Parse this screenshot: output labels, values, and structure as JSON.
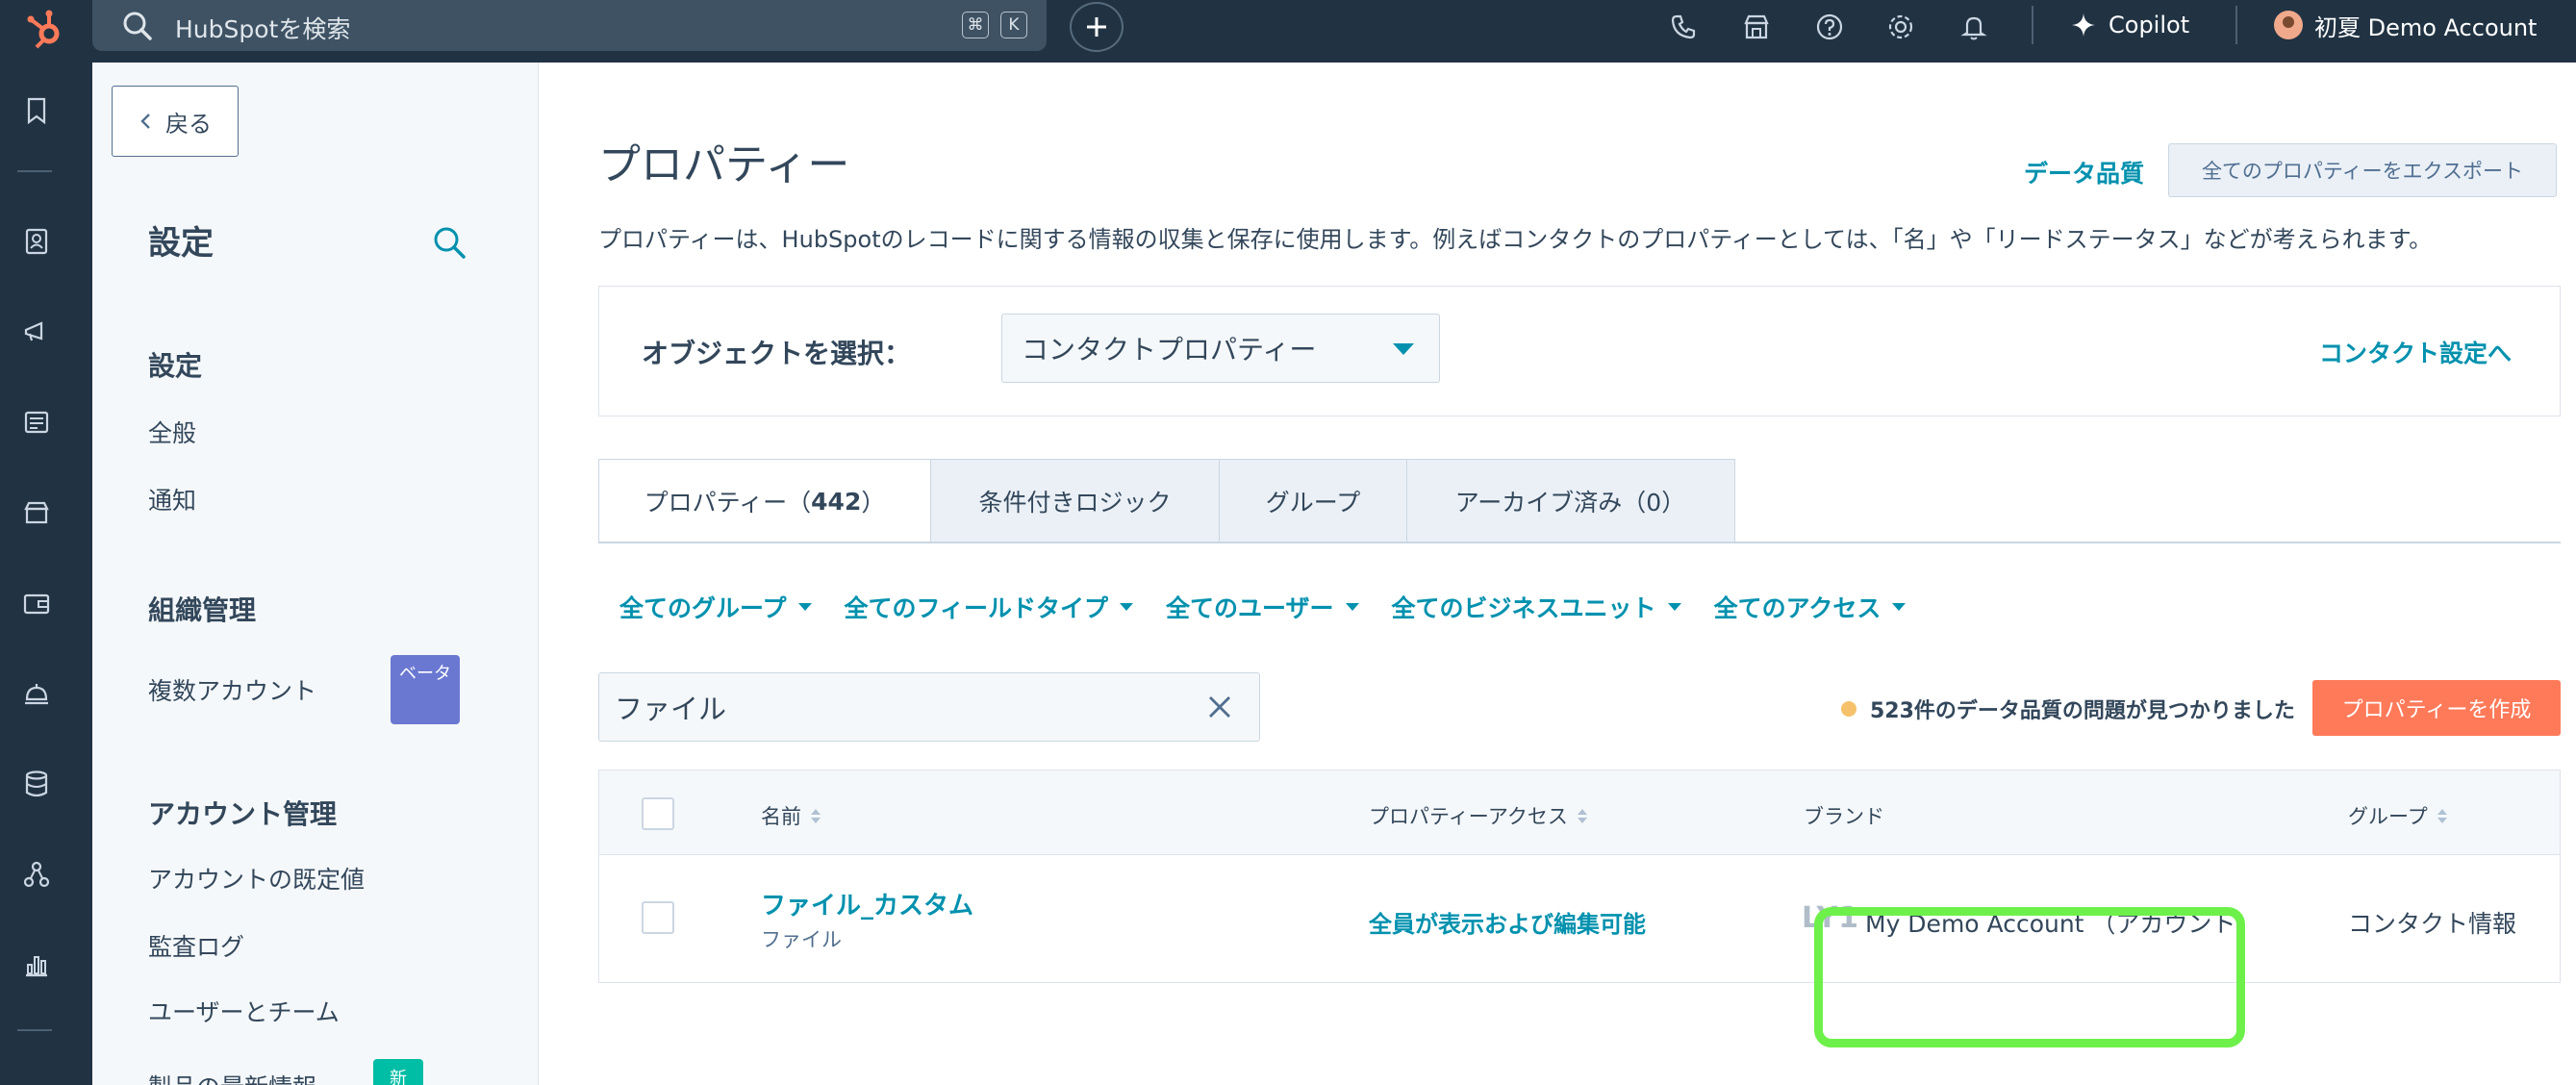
{
  "topbar": {
    "search_placeholder": "HubSpotを検索",
    "shortcut_keys": [
      "⌘",
      "K"
    ],
    "copilot_label": "Copilot",
    "account_label": "初夏 Demo Account",
    "icons": [
      "phone-icon",
      "marketplace-icon",
      "help-icon",
      "settings-icon",
      "notifications-icon"
    ]
  },
  "leftnav": {
    "icons": [
      "bookmark-icon",
      "contacts-icon",
      "marketing-icon",
      "content-icon",
      "commerce-icon",
      "sales-icon",
      "service-icon",
      "data-icon",
      "automation-icon",
      "reporting-icon"
    ]
  },
  "sidebar": {
    "back_label": "戻る",
    "title": "設定",
    "sections": [
      {
        "heading": "設定",
        "items": [
          "全般",
          "通知"
        ]
      },
      {
        "heading": "組織管理",
        "items": [
          "複数アカウント"
        ]
      },
      {
        "heading": "アカウント管理",
        "items": [
          "アカウントの既定値",
          "監査ログ",
          "ユーザーとチーム",
          "製品の最新情報"
        ]
      }
    ],
    "beta_badge": "ベータ",
    "new_badge": "新"
  },
  "main": {
    "title": "プロパティー",
    "data_quality_link": "データ品質",
    "export_button": "全てのプロパティーをエクスポート",
    "description": "プロパティーは、HubSpotのレコードに関する情報の収集と保存に使用します。例えばコンタクトのプロパティーとしては、「名」や「リードステータス」などが考えられます。",
    "object_select_label": "オブジェクトを選択：",
    "object_select_value": "コンタクトプロパティー",
    "contact_settings_link": "コンタクト設定へ",
    "tabs": [
      {
        "label": "プロパティー（",
        "count": "442",
        "suffix": "）"
      },
      {
        "label": "条件付きロジック"
      },
      {
        "label": "グループ"
      },
      {
        "label": "アーカイブ済み（0）"
      }
    ],
    "filters": [
      "全てのグループ",
      "全てのフィールドタイプ",
      "全てのユーザー",
      "全てのビジネスユニット",
      "全てのアクセス"
    ],
    "search_value": "ファイル",
    "data_quality_issue": "523件のデータ品質の問題が見つかりました",
    "create_button": "プロパティーを作成",
    "table": {
      "columns": [
        "名前",
        "プロパティーアクセス",
        "ブランド",
        "グループ"
      ],
      "rows": [
        {
          "name": "ファイル_カスタム",
          "type": "ファイル",
          "access": "全員が表示および編集可能",
          "brand_logo": "LY1",
          "brand": "My Demo Account （アカウント）",
          "group": "コンタクト情報"
        }
      ]
    }
  },
  "colors": {
    "topbar": "#213343",
    "link": "#0091ae",
    "primary_button": "#ff7a59",
    "highlight": "#6df04a",
    "beta": "#6a78d1",
    "new": "#00bda5"
  }
}
